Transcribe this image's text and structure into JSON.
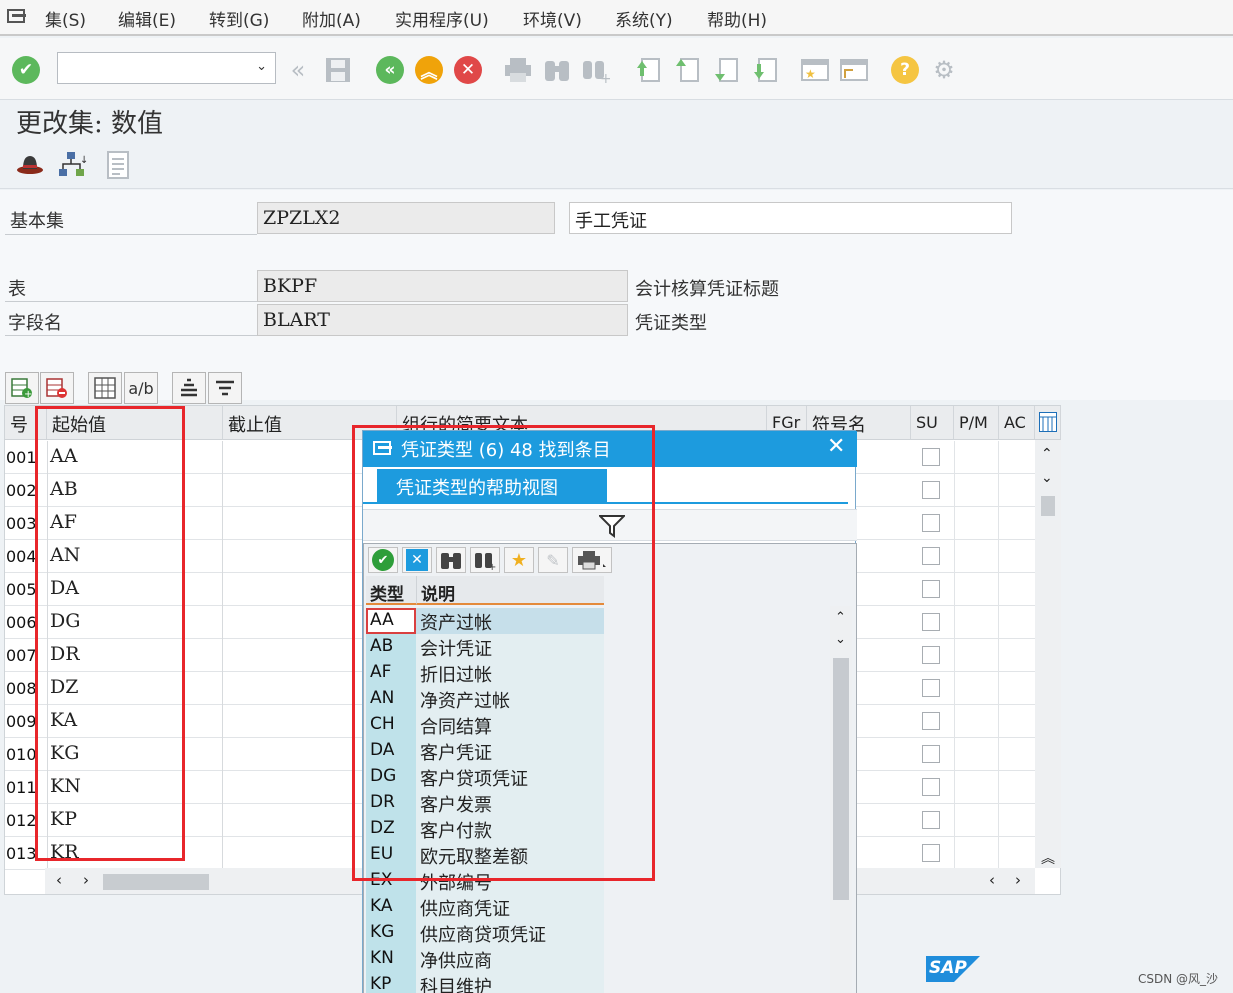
{
  "menu": [
    {
      "label": "集(S)"
    },
    {
      "label": "编辑(E)"
    },
    {
      "label": "转到(G)"
    },
    {
      "label": "附加(A)"
    },
    {
      "label": "实用程序(U)"
    },
    {
      "label": "环境(V)"
    },
    {
      "label": "系统(Y)"
    },
    {
      "label": "帮助(H)"
    }
  ],
  "page": {
    "title": "更改集: 数值"
  },
  "form": {
    "basic_set_label": "基本集",
    "basic_set_value": "ZPZLX2",
    "basic_set_desc": "手工凭证",
    "table_label": "表",
    "table_value": "BKPF",
    "table_desc": "会计核算凭证标题",
    "field_label": "字段名",
    "field_value": "BLART",
    "field_desc": "凭证类型"
  },
  "table": {
    "columns": {
      "no": "号",
      "from": "起始值",
      "to": "截止值",
      "text": "组行的简要文本",
      "fgr": "FGr",
      "symbol": "符号名",
      "su": "SU",
      "pm": "P/M",
      "ac": "AC"
    },
    "rows": [
      {
        "no": "001",
        "from": "AA"
      },
      {
        "no": "002",
        "from": "AB"
      },
      {
        "no": "003",
        "from": "AF"
      },
      {
        "no": "004",
        "from": "AN"
      },
      {
        "no": "005",
        "from": "DA"
      },
      {
        "no": "006",
        "from": "DG"
      },
      {
        "no": "007",
        "from": "DR"
      },
      {
        "no": "008",
        "from": "DZ"
      },
      {
        "no": "009",
        "from": "KA"
      },
      {
        "no": "010",
        "from": "KG"
      },
      {
        "no": "011",
        "from": "KN"
      },
      {
        "no": "012",
        "from": "KP"
      },
      {
        "no": "013",
        "from": "KR"
      }
    ]
  },
  "dialog": {
    "title": "凭证类型 (6)   48 找到条目",
    "tab": "凭证类型的帮助视图",
    "col_type": "类型",
    "col_desc": "说明",
    "entries": [
      {
        "code": "AA",
        "desc": "资产过帐"
      },
      {
        "code": "AB",
        "desc": "会计凭证"
      },
      {
        "code": "AF",
        "desc": "折旧过帐"
      },
      {
        "code": "AN",
        "desc": "净资产过帐"
      },
      {
        "code": "CH",
        "desc": "合同结算"
      },
      {
        "code": "DA",
        "desc": "客户凭证"
      },
      {
        "code": "DG",
        "desc": "客户贷项凭证"
      },
      {
        "code": "DR",
        "desc": "客户发票"
      },
      {
        "code": "DZ",
        "desc": "客户付款"
      },
      {
        "code": "EU",
        "desc": "欧元取整差额"
      },
      {
        "code": "EX",
        "desc": "外部编号"
      },
      {
        "code": "KA",
        "desc": "供应商凭证"
      },
      {
        "code": "KG",
        "desc": "供应商贷项凭证"
      },
      {
        "code": "KN",
        "desc": "净供应商"
      },
      {
        "code": "KP",
        "desc": "科目维护"
      }
    ]
  },
  "footer": {
    "sap_logo": "SAP",
    "watermark": "CSDN @风_沙"
  },
  "colors": {
    "accent": "#1d9bde",
    "highlight_box": "#e8262b",
    "code_cell": "#bfe2ea"
  },
  "icons": [
    "menu-icon",
    "enter-check-icon",
    "back-icon",
    "save-icon",
    "green-back-icon",
    "exit-icon",
    "cancel-icon",
    "print-icon",
    "find-icon",
    "find-next-icon",
    "first-page-icon",
    "previous-page-icon",
    "next-page-icon",
    "last-page-icon",
    "new-session-icon",
    "shortcut-icon",
    "help-icon",
    "settings-gear-icon"
  ]
}
